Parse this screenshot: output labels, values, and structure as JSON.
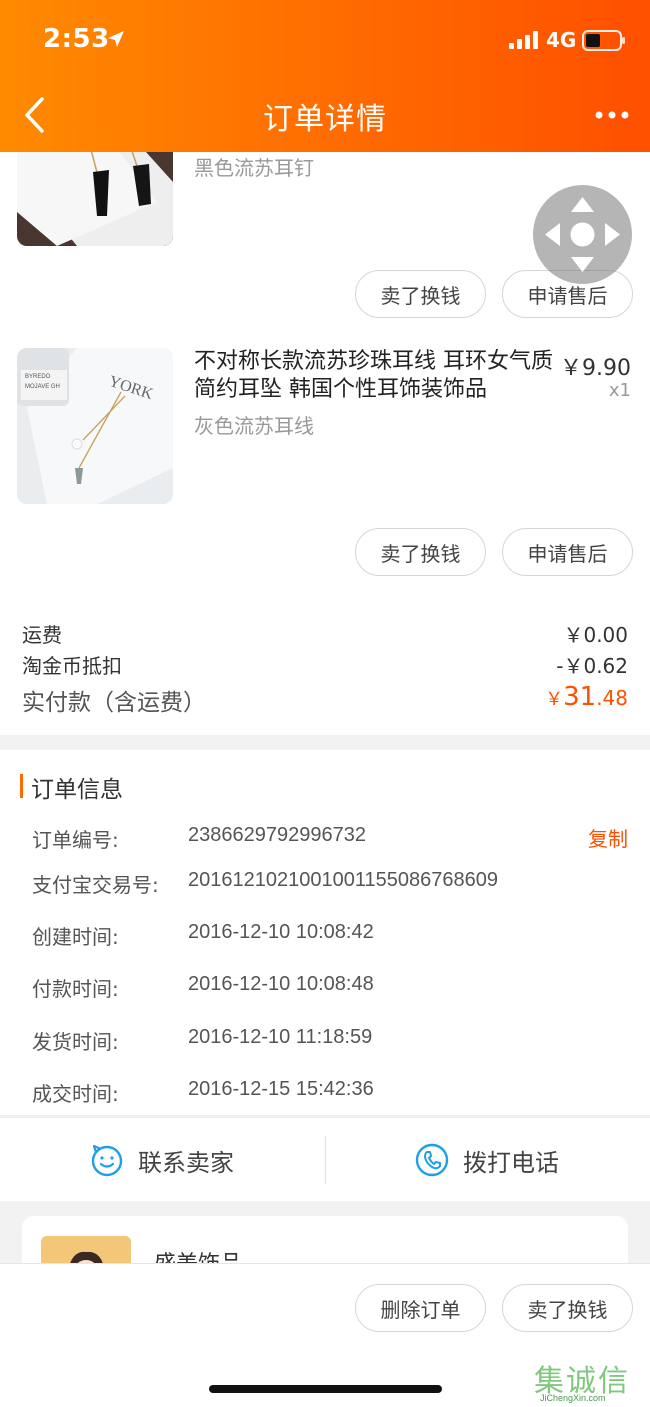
{
  "status_bar": {
    "time": "2:53",
    "network": "4G"
  },
  "nav": {
    "title": "订单详情"
  },
  "products": [
    {
      "variant": "黑色流苏耳钉",
      "actions": [
        "卖了换钱",
        "申请售后"
      ]
    },
    {
      "name": "不对称长款流苏珍珠耳线 耳环女气质简约耳坠 韩国个性耳饰装饰品",
      "price": "￥9.90",
      "qty": "x1",
      "variant": "灰色流苏耳线",
      "actions": [
        "卖了换钱",
        "申请售后"
      ]
    }
  ],
  "fees": {
    "shipping_label": "运费",
    "shipping_value": "￥0.00",
    "coin_label": "淘金币抵扣",
    "coin_value": "-￥0.62",
    "paid_label": "实付款（含运费）",
    "paid_currency": "￥",
    "paid_int": "31",
    "paid_dec": ".48"
  },
  "order_info": {
    "title": "订单信息",
    "copy": "复制",
    "rows": [
      {
        "label": "订单编号:",
        "value": "2386629792996732"
      },
      {
        "label": "支付宝交易号:",
        "value": "2016121021001001155086768609"
      },
      {
        "label": "创建时间:",
        "value": "2016-12-10 10:08:42"
      },
      {
        "label": "付款时间:",
        "value": "2016-12-10 10:08:48"
      },
      {
        "label": "发货时间:",
        "value": "2016-12-10 11:18:59"
      },
      {
        "label": "成交时间:",
        "value": "2016-12-15 15:42:36"
      }
    ]
  },
  "contact": {
    "seller": "联系卖家",
    "phone": "拨打电话"
  },
  "shop": {
    "name": "盛美饰品"
  },
  "bottom": {
    "delete": "删除订单",
    "sell": "卖了换钱"
  },
  "watermark": {
    "text": "集诚信",
    "sub": "JiChengXin.com"
  },
  "colors": {
    "accent": "#ff5000",
    "header_start": "#ff8a00",
    "header_end": "#ff4f00",
    "icon_blue": "#1ea0e6"
  }
}
